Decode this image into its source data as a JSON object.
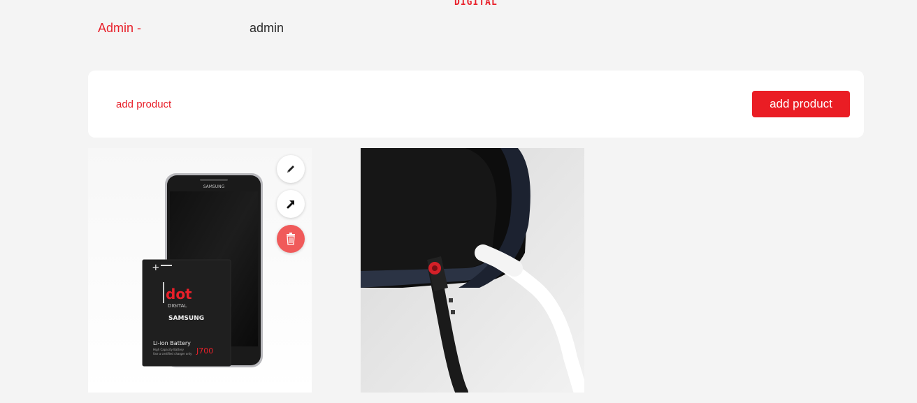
{
  "brand": {
    "logo_text": "DIGITAL",
    "accent": "#e8202a"
  },
  "header": {
    "role_label": "Admin -",
    "username": "admin"
  },
  "toolbar": {
    "title": "add product",
    "button_label": "add product"
  },
  "products": [
    {
      "actions": [
        {
          "name": "edit",
          "icon": "pencil-icon"
        },
        {
          "name": "open",
          "icon": "arrow-up-right-icon"
        },
        {
          "name": "delete",
          "icon": "trash-icon"
        }
      ],
      "image_text": {
        "phone_brand": "SAMSUNG",
        "pack_logo": "dot",
        "pack_logo_sub": "DIGITAL",
        "pack_brand": "SAMSUNG",
        "pack_type": "Li-ion Battery",
        "pack_capacity": "High Capacity Battery",
        "pack_note": "Use a certified charger only",
        "pack_model": "J700"
      }
    },
    {
      "actions": []
    }
  ]
}
